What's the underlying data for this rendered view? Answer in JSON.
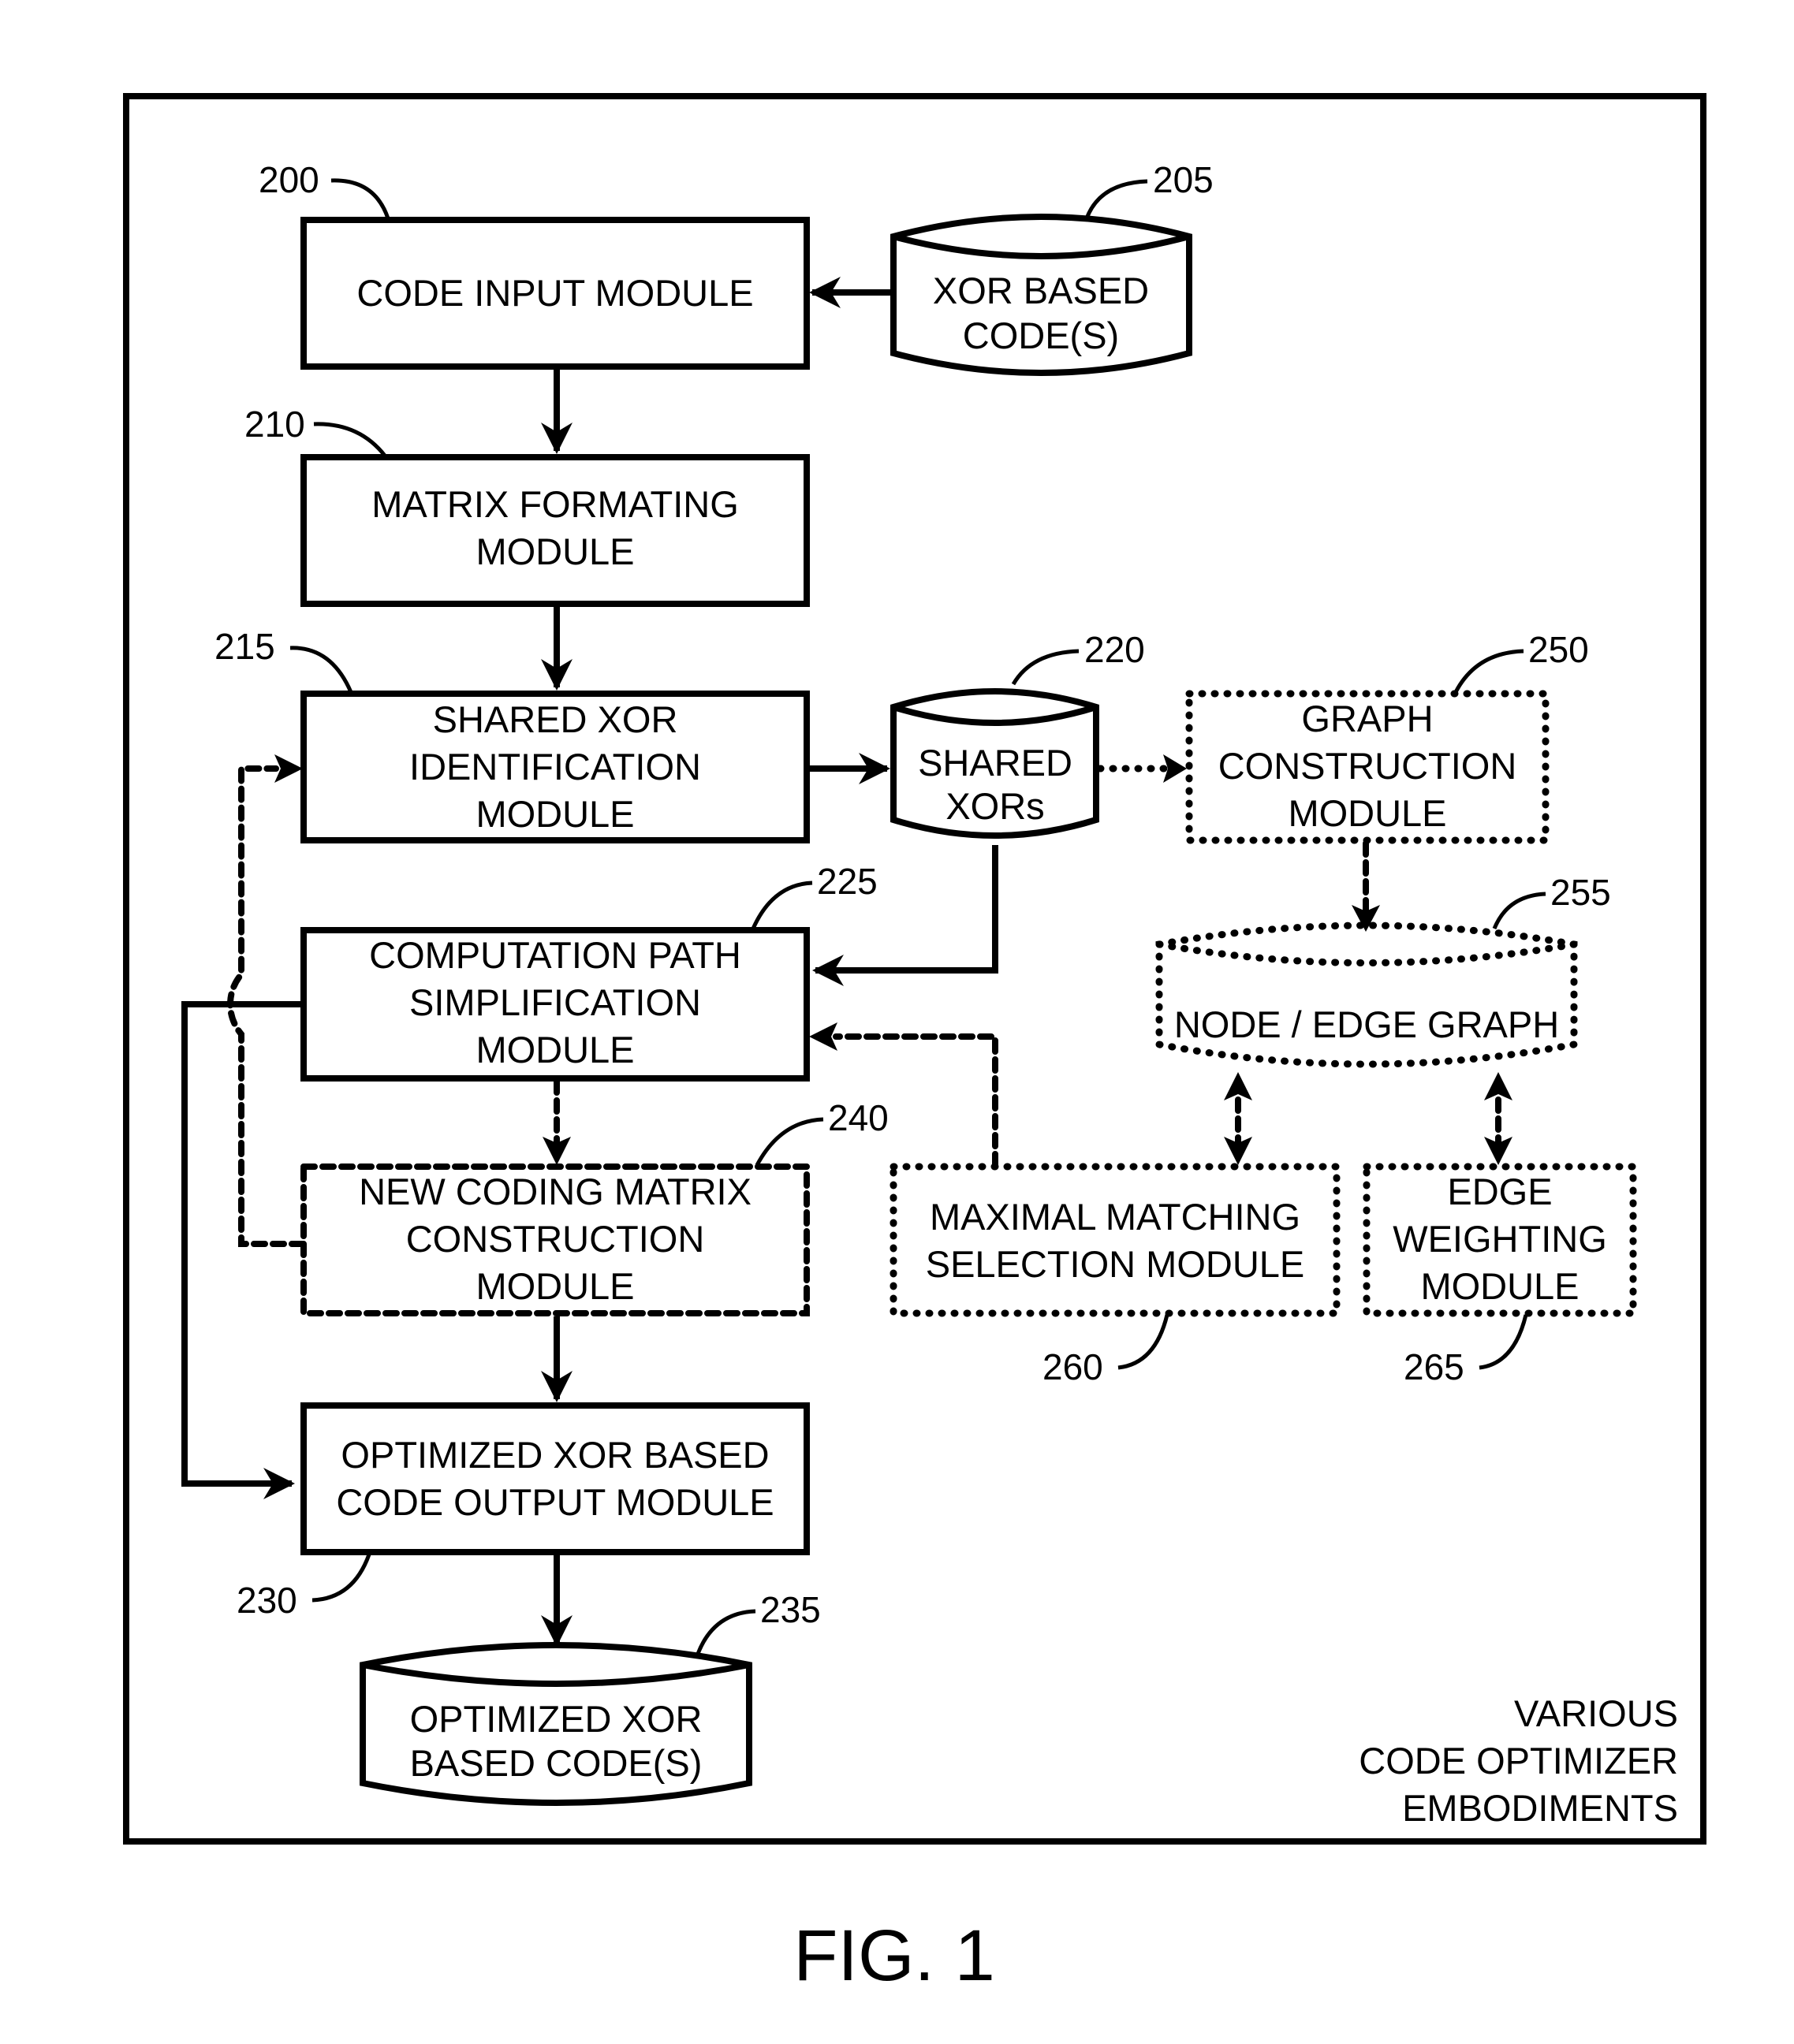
{
  "figure": {
    "caption": "FIG. 1",
    "frame_label_lines": [
      "VARIOUS",
      "CODE OPTIMIZER",
      "EMBODIMENTS"
    ]
  },
  "modules": {
    "code_input": {
      "ref": "200",
      "lines": [
        "CODE INPUT MODULE"
      ],
      "style": "solid",
      "shape": "box"
    },
    "xor_codes": {
      "ref": "205",
      "lines": [
        "XOR BASED",
        "CODE(S)"
      ],
      "style": "solid",
      "shape": "cylinder"
    },
    "matrix_formatting": {
      "ref": "210",
      "lines": [
        "MATRIX FORMATING",
        "MODULE"
      ],
      "style": "solid",
      "shape": "box"
    },
    "shared_xor_id": {
      "ref": "215",
      "lines": [
        "SHARED XOR",
        "IDENTIFICATION",
        "MODULE"
      ],
      "style": "solid",
      "shape": "box"
    },
    "shared_xors": {
      "ref": "220",
      "lines": [
        "SHARED",
        "XORs"
      ],
      "style": "solid",
      "shape": "cylinder"
    },
    "comp_path": {
      "ref": "225",
      "lines": [
        "COMPUTATION PATH",
        "SIMPLIFICATION",
        "MODULE"
      ],
      "style": "solid",
      "shape": "box"
    },
    "optimized_output": {
      "ref": "230",
      "lines": [
        "OPTIMIZED XOR BASED",
        "CODE OUTPUT MODULE"
      ],
      "style": "solid",
      "shape": "box"
    },
    "optimized_codes": {
      "ref": "235",
      "lines": [
        "OPTIMIZED XOR",
        "BASED CODE(S)"
      ],
      "style": "solid",
      "shape": "cylinder"
    },
    "new_coding_matrix": {
      "ref": "240",
      "lines": [
        "NEW CODING MATRIX",
        "CONSTRUCTION",
        "MODULE"
      ],
      "style": "dashed",
      "shape": "box"
    },
    "graph_construction": {
      "ref": "250",
      "lines": [
        "GRAPH",
        "CONSTRUCTION",
        "MODULE"
      ],
      "style": "dashed",
      "shape": "box"
    },
    "node_edge_graph": {
      "ref": "255",
      "lines": [
        "NODE / EDGE GRAPH"
      ],
      "style": "dashed",
      "shape": "cylinder"
    },
    "maximal_matching": {
      "ref": "260",
      "lines": [
        "MAXIMAL MATCHING",
        "SELECTION MODULE"
      ],
      "style": "dashed",
      "shape": "box"
    },
    "edge_weighting": {
      "ref": "265",
      "lines": [
        "EDGE",
        "WEIGHTING",
        "MODULE"
      ],
      "style": "dashed",
      "shape": "box"
    }
  },
  "connections": [
    {
      "from": "xor_codes",
      "to": "code_input",
      "style": "solid"
    },
    {
      "from": "code_input",
      "to": "matrix_formatting",
      "style": "solid"
    },
    {
      "from": "matrix_formatting",
      "to": "shared_xor_id",
      "style": "solid"
    },
    {
      "from": "shared_xor_id",
      "to": "shared_xors",
      "style": "solid"
    },
    {
      "from": "shared_xors",
      "to": "comp_path",
      "style": "solid"
    },
    {
      "from": "shared_xors",
      "to": "graph_construction",
      "style": "dashed"
    },
    {
      "from": "graph_construction",
      "to": "node_edge_graph",
      "style": "dashed"
    },
    {
      "from": "node_edge_graph",
      "to": "maximal_matching",
      "style": "dashed",
      "bidirectional": true
    },
    {
      "from": "node_edge_graph",
      "to": "edge_weighting",
      "style": "dashed",
      "bidirectional": true
    },
    {
      "from": "maximal_matching",
      "to": "comp_path",
      "style": "dashed"
    },
    {
      "from": "comp_path",
      "to": "new_coding_matrix",
      "style": "dashed"
    },
    {
      "from": "new_coding_matrix",
      "to": "shared_xor_id",
      "style": "dashed"
    },
    {
      "from": "new_coding_matrix",
      "to": "optimized_output",
      "style": "solid"
    },
    {
      "from": "comp_path",
      "to": "optimized_output",
      "style": "solid"
    },
    {
      "from": "optimized_output",
      "to": "optimized_codes",
      "style": "solid"
    }
  ]
}
